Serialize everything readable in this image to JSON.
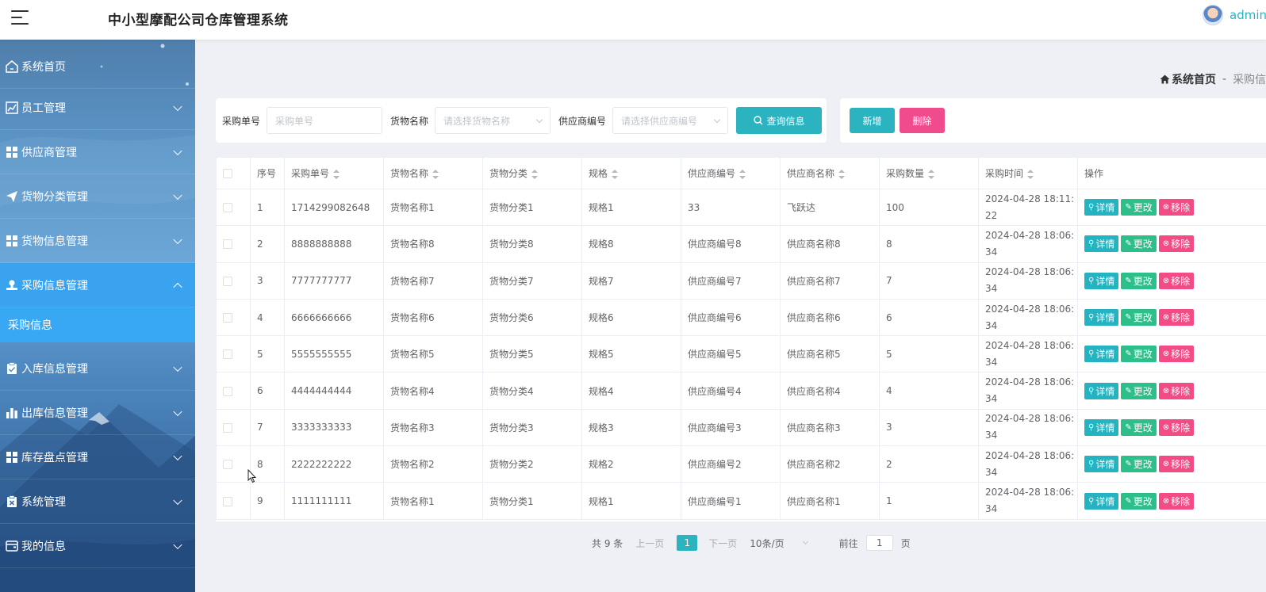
{
  "header": {
    "title": "中小型摩配公司仓库管理系统",
    "username": "admin"
  },
  "sidebar": {
    "items": [
      {
        "label": "系统首页",
        "icon": "home-icon"
      },
      {
        "label": "员工管理",
        "icon": "chart-line-icon"
      },
      {
        "label": "供应商管理",
        "icon": "grid-icon"
      },
      {
        "label": "货物分类管理",
        "icon": "paper-plane-icon"
      },
      {
        "label": "货物信息管理",
        "icon": "grid-icon"
      },
      {
        "label": "采购信息管理",
        "icon": "stamp-icon"
      },
      {
        "label": "入库信息管理",
        "icon": "clipboard-check-icon"
      },
      {
        "label": "出库信息管理",
        "icon": "bar-chart-icon"
      },
      {
        "label": "库存盘点管理",
        "icon": "grid-icon"
      },
      {
        "label": "系统管理",
        "icon": "clipboard-x-icon"
      },
      {
        "label": "我的信息",
        "icon": "wallet-icon"
      }
    ],
    "submenu": {
      "label": "采购信息"
    }
  },
  "breadcrumb": {
    "home": "系统首页",
    "separator": "-",
    "current": "采购信"
  },
  "search": {
    "purchase_no_label": "采购单号",
    "purchase_no_placeholder": "采购单号",
    "goods_name_label": "货物名称",
    "goods_name_placeholder": "请选择货物名称",
    "supplier_no_label": "供应商编号",
    "supplier_no_placeholder": "请选择供应商编号",
    "query_button": "查询信息"
  },
  "actions": {
    "add_button": "新增",
    "delete_button": "删除"
  },
  "table": {
    "columns": [
      "序号",
      "采购单号",
      "货物名称",
      "货物分类",
      "规格",
      "供应商编号",
      "供应商名称",
      "采购数量",
      "采购时间",
      "操作"
    ],
    "rows": [
      {
        "idx": "1",
        "no": "1714299082648",
        "goods": "货物名称1",
        "cat": "货物分类1",
        "spec": "规格1",
        "sup_no": "33",
        "sup_name": "飞跃达",
        "qty": "100",
        "time1": "2024-04-28 18:11:",
        "time2": "22"
      },
      {
        "idx": "2",
        "no": "8888888888",
        "goods": "货物名称8",
        "cat": "货物分类8",
        "spec": "规格8",
        "sup_no": "供应商编号8",
        "sup_name": "供应商名称8",
        "qty": "8",
        "time1": "2024-04-28 18:06:",
        "time2": "34"
      },
      {
        "idx": "3",
        "no": "7777777777",
        "goods": "货物名称7",
        "cat": "货物分类7",
        "spec": "规格7",
        "sup_no": "供应商编号7",
        "sup_name": "供应商名称7",
        "qty": "7",
        "time1": "2024-04-28 18:06:",
        "time2": "34"
      },
      {
        "idx": "4",
        "no": "6666666666",
        "goods": "货物名称6",
        "cat": "货物分类6",
        "spec": "规格6",
        "sup_no": "供应商编号6",
        "sup_name": "供应商名称6",
        "qty": "6",
        "time1": "2024-04-28 18:06:",
        "time2": "34"
      },
      {
        "idx": "5",
        "no": "5555555555",
        "goods": "货物名称5",
        "cat": "货物分类5",
        "spec": "规格5",
        "sup_no": "供应商编号5",
        "sup_name": "供应商名称5",
        "qty": "5",
        "time1": "2024-04-28 18:06:",
        "time2": "34"
      },
      {
        "idx": "6",
        "no": "4444444444",
        "goods": "货物名称4",
        "cat": "货物分类4",
        "spec": "规格4",
        "sup_no": "供应商编号4",
        "sup_name": "供应商名称4",
        "qty": "4",
        "time1": "2024-04-28 18:06:",
        "time2": "34"
      },
      {
        "idx": "7",
        "no": "3333333333",
        "goods": "货物名称3",
        "cat": "货物分类3",
        "spec": "规格3",
        "sup_no": "供应商编号3",
        "sup_name": "供应商名称3",
        "qty": "3",
        "time1": "2024-04-28 18:06:",
        "time2": "34"
      },
      {
        "idx": "8",
        "no": "2222222222",
        "goods": "货物名称2",
        "cat": "货物分类2",
        "spec": "规格2",
        "sup_no": "供应商编号2",
        "sup_name": "供应商名称2",
        "qty": "2",
        "time1": "2024-04-28 18:06:",
        "time2": "34"
      },
      {
        "idx": "9",
        "no": "1111111111",
        "goods": "货物名称1",
        "cat": "货物分类1",
        "spec": "规格1",
        "sup_no": "供应商编号1",
        "sup_name": "供应商名称1",
        "qty": "1",
        "time1": "2024-04-28 18:06:",
        "time2": "34"
      }
    ],
    "row_actions": {
      "detail": "详情",
      "edit": "更改",
      "remove": "移除"
    }
  },
  "pagination": {
    "total": "共 9 条",
    "prev": "上一页",
    "page": "1",
    "next": "下一页",
    "page_size": "10条/页",
    "goto_label": "前往",
    "goto_value": "1",
    "page_suffix": "页"
  },
  "colors": {
    "primary": "#2bb4c0",
    "danger": "#f04b8c",
    "edit": "#2dbf8a",
    "sidebar_active": "#3aa3ef"
  }
}
